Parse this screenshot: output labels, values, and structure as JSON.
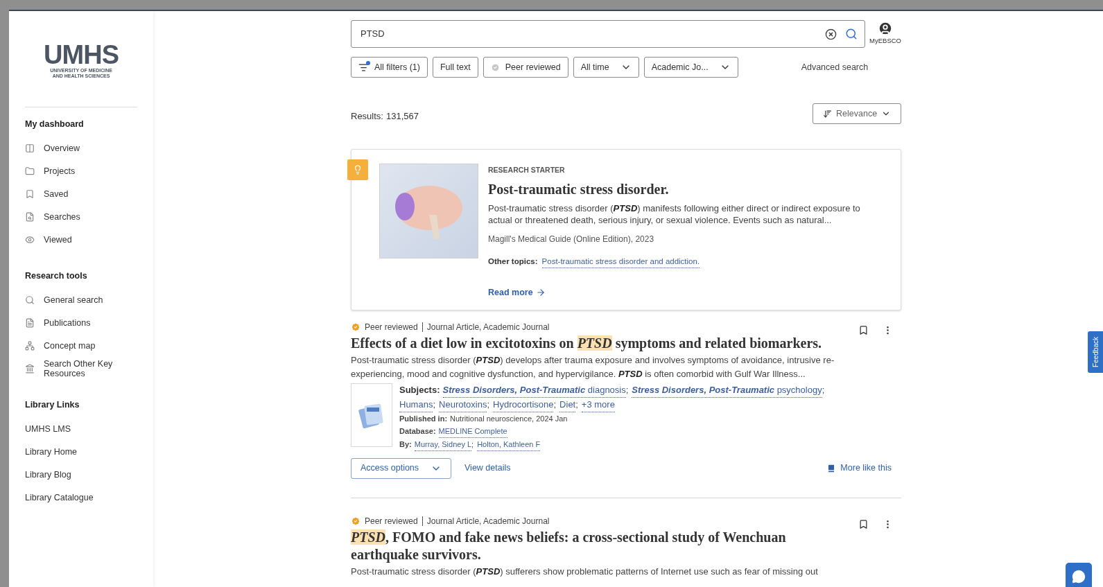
{
  "logo": {
    "wordmark": "UMHS",
    "subtitle": "UNIVERSITY OF MEDICINE AND HEALTH SCIENCES"
  },
  "sidebar": [
    {
      "title": "My dashboard",
      "kind": "icons",
      "items": [
        {
          "label": "Overview"
        },
        {
          "label": "Projects"
        },
        {
          "label": "Saved"
        },
        {
          "label": "Searches"
        },
        {
          "label": "Viewed"
        }
      ]
    },
    {
      "title": "Research tools",
      "kind": "icons",
      "items": [
        {
          "label": "General search"
        },
        {
          "label": "Publications"
        },
        {
          "label": "Concept map"
        },
        {
          "label": "Search Other Key Resources"
        }
      ]
    },
    {
      "title": "Library Links",
      "kind": "plain",
      "items": [
        {
          "label": "UMHS LMS"
        },
        {
          "label": "Library Home"
        },
        {
          "label": "Library Blog"
        },
        {
          "label": "Library Catalogue"
        }
      ]
    }
  ],
  "search": {
    "value": "PTSD",
    "account_label": "MyEBSCO"
  },
  "filters": [
    {
      "label": "All filters (1)",
      "kind": "filters"
    },
    {
      "label": "Full text",
      "kind": "plain"
    },
    {
      "label": "Peer reviewed",
      "kind": "toggle"
    },
    {
      "label": "All time",
      "kind": "dropdown"
    },
    {
      "label": "Academic Jo...",
      "kind": "dropdown"
    }
  ],
  "advanced_search": "Advanced search",
  "results_count": {
    "label": "Results:",
    "value": "131,567"
  },
  "sort": {
    "label": "Relevance"
  },
  "research_starter": {
    "eyebrow": "RESEARCH STARTER",
    "title": "Post-traumatic stress disorder.",
    "abstract": "Post-traumatic stress disorder (**PTSD**) manifests following either direct or indirect exposure to actual or threatened death, serious injury, or sexual violence. Events such as natural...",
    "source": "Magill's Medical Guide (Online Edition), 2023",
    "other_topics_label": "Other topics:",
    "other_topics": [
      "Post-traumatic stress disorder and addiction."
    ],
    "read_more": "Read more"
  },
  "results": [
    {
      "badge": "Peer reviewed",
      "type": "Journal Article, Academic Journal",
      "title": [
        {
          "text": "Effects of a diet low in excitotoxins on ",
          "highlight": false
        },
        {
          "text": "PTSD",
          "highlight": true
        },
        {
          "text": " symptoms and related biomarkers.",
          "highlight": false
        }
      ],
      "abstract": "Post-traumatic stress disorder (**PTSD**) develops after trauma exposure and involves symptoms of avoidance, intrusive re-experiencing, mood and cognitive dysfunction, and hypervigilance. **PTSD** is often comorbid with Gulf War Illness...",
      "subjects_label": "Subjects:",
      "subjects": [
        {
          "text": "**Stress Disorders, Post-Traumatic** diagnosis",
          "separator": ";"
        },
        {
          "text": "**Stress Disorders, Post-Traumatic** psychology",
          "separator": ";"
        },
        {
          "text": "Humans",
          "separator": ";"
        },
        {
          "text": "Neurotoxins",
          "separator": ";"
        },
        {
          "text": "Hydrocortisone",
          "separator": ";"
        },
        {
          "text": "Diet",
          "separator": ";"
        },
        {
          "text": "+3 more"
        }
      ],
      "published_label": "Published in:",
      "published": "Nutritional neuroscience, 2024 Jan",
      "database_label": "Database:",
      "database": "MEDLINE Complete",
      "authors_label": "By:",
      "authors": [
        {
          "text": "Murray, Sidney L",
          "separator": ";"
        },
        {
          "text": "Holton, Kathleen F"
        }
      ],
      "access": "Access options",
      "details": "View details",
      "more_like": "More like this"
    },
    {
      "badge": "Peer reviewed",
      "type": "Journal Article, Academic Journal",
      "title": [
        {
          "text": "PTSD",
          "highlight": true
        },
        {
          "text": ", FOMO and fake news beliefs: a cross-sectional study of Wenchuan earthquake survivors.",
          "highlight": false
        }
      ],
      "abstract": "Post-traumatic stress disorder (**PTSD**) sufferers show problematic patterns of Internet use such as fear of missing out"
    }
  ],
  "feedback": "Feedback"
}
